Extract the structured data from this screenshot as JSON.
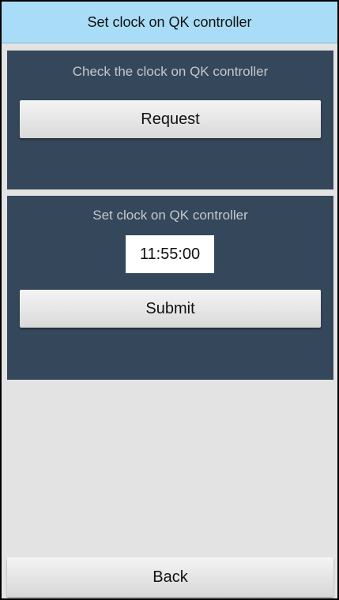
{
  "header": {
    "title": "Set clock on QK controller"
  },
  "check_panel": {
    "caption": "Check the clock on QK controller",
    "request_label": "Request"
  },
  "set_panel": {
    "caption": "Set clock on QK controller",
    "time_value": "11:55:00",
    "submit_label": "Submit"
  },
  "footer": {
    "back_label": "Back"
  },
  "colors": {
    "title_bar": "#a9dcf6",
    "panel": "#35475b",
    "background": "#e3e3e3"
  }
}
